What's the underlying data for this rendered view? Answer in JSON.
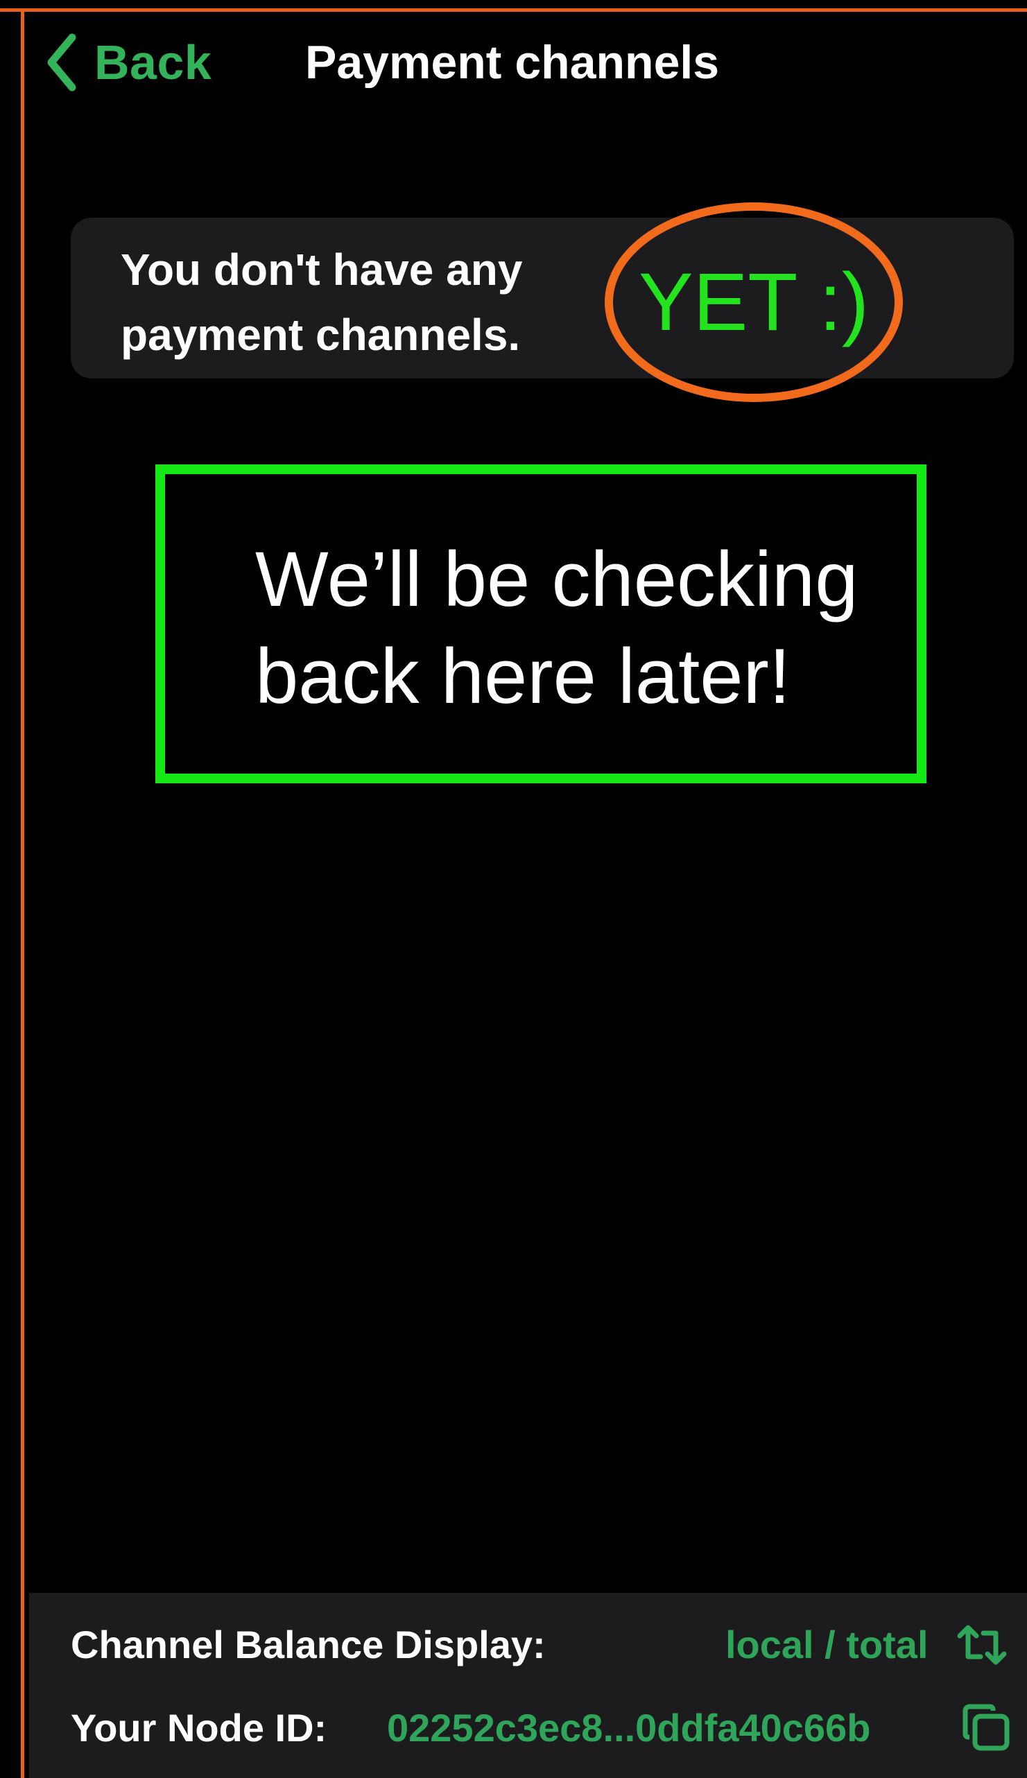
{
  "header": {
    "back_label": "Back",
    "title": "Payment channels"
  },
  "empty_state": {
    "message": "You don't have any payment channels."
  },
  "annotations": {
    "yet": "YET :)",
    "note": "We’ll be checking back here later!"
  },
  "footer": {
    "balance_display_label": "Channel Balance Display:",
    "balance_display_value": "local / total",
    "node_id_label": "Your Node ID:",
    "node_id_value": "02252c3ec8...0ddfa40c66b"
  },
  "icons": {
    "back": "chevron-left-icon",
    "toggle": "swap-arrows-icon",
    "copy": "copy-icon"
  },
  "colors": {
    "accent": "#2fa55a",
    "annotation_orange": "#f26b1d",
    "annotation_green": "#16e816",
    "card": "#1c1c1e"
  }
}
